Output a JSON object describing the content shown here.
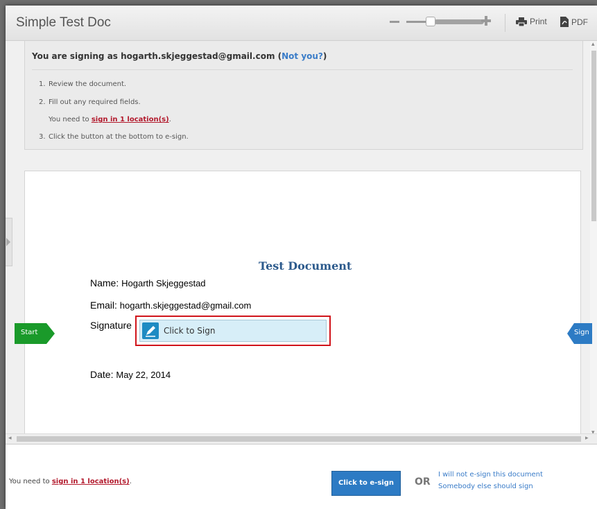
{
  "titlebar": {
    "title": "Simple Test Doc",
    "print_label": "Print",
    "pdf_label": "PDF"
  },
  "info": {
    "signing_as_prefix": "You are signing as ",
    "email": "hogarth.skjeggestad@gmail.com",
    "open_paren": " (",
    "not_you": "Not you?",
    "close_paren": ")",
    "steps": [
      {
        "num": "1.",
        "text": "Review the document."
      },
      {
        "num": "2.",
        "text": "Fill out any required fields."
      },
      {
        "num": "3.",
        "text": "Click the button at the bottom to e-sign."
      }
    ],
    "need_prefix": "You need to ",
    "need_link": "sign in 1 location(s)",
    "need_suffix": "."
  },
  "document": {
    "heading": "Test Document",
    "name_label": "Name:",
    "name_value": "Hogarth Skjeggestad",
    "email_label": "Email:",
    "email_value": "hogarth.skjeggestad@gmail.com",
    "signature_label": "Signature",
    "click_to_sign": "Click to Sign",
    "date_label": "Date:",
    "date_value": "May 22, 2014"
  },
  "flags": {
    "start": "Start",
    "sign": "Sign"
  },
  "footer": {
    "need_prefix": "You need to ",
    "need_link": "sign in 1 location(s)",
    "need_suffix": ".",
    "esign_button": "Click to e-sign",
    "or_label": "OR",
    "decline_line1": "I will not e-sign this document",
    "decline_line2": "Somebody else should sign"
  },
  "colors": {
    "accent_blue": "#2d7bc4",
    "link_red": "#b2182b",
    "start_green": "#1a9a2a",
    "highlight_red": "#d0141b",
    "heading_blue": "#2c5a8c"
  },
  "icons": {
    "print": "printer-icon",
    "pdf": "pdf-icon",
    "pen": "pen-icon"
  }
}
